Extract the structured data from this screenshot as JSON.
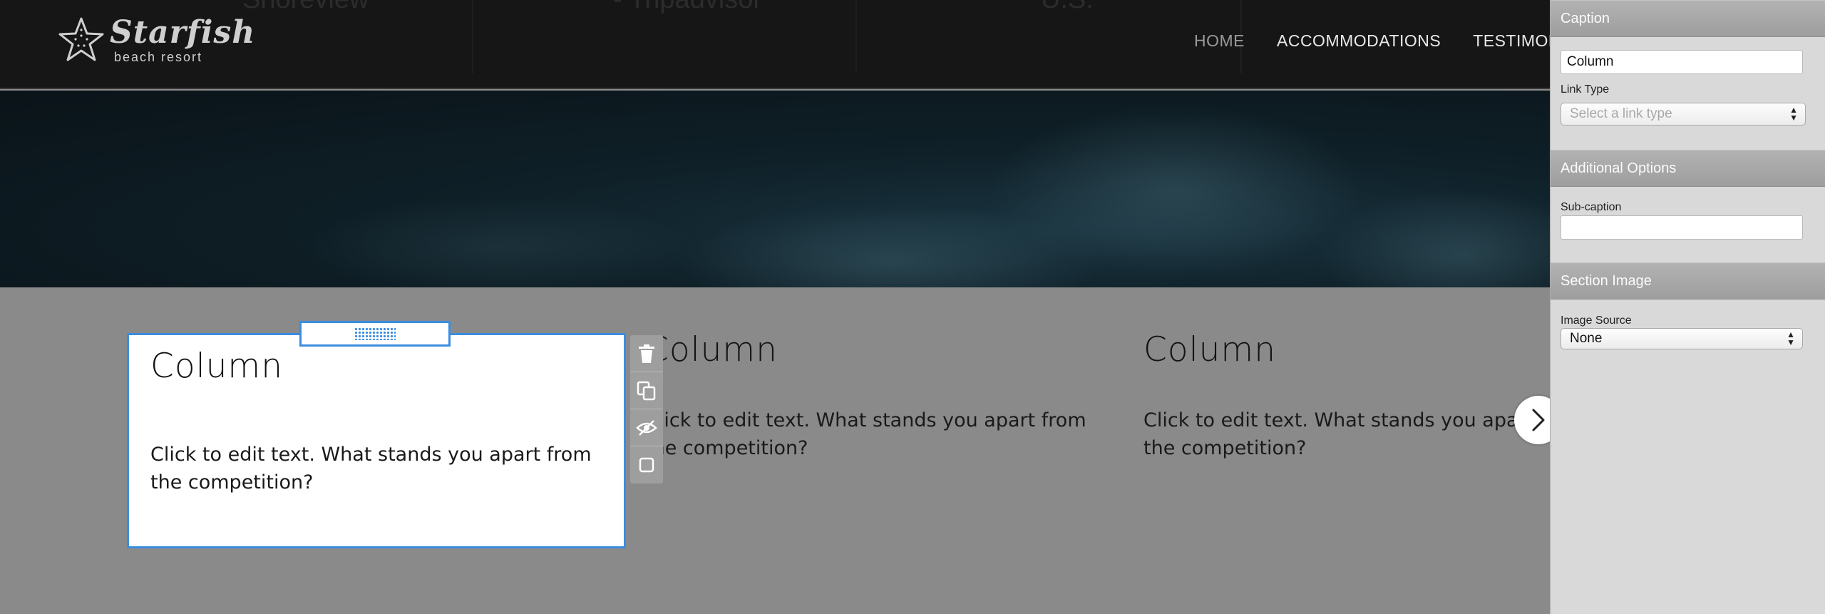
{
  "header": {
    "ghost_testimonials": [
      "Shoreview",
      "- Tripadvisor",
      "U.S."
    ],
    "logo": {
      "name": "Starfish",
      "tagline": "beach resort"
    },
    "nav": [
      {
        "label": "HOME",
        "active": true
      },
      {
        "label": "ACCOMMODATIONS",
        "active": false
      },
      {
        "label": "TESTIMONIA",
        "active": false
      }
    ]
  },
  "columns": [
    {
      "title": "Column",
      "text": "Click to edit text. What stands you apart from the competition?"
    },
    {
      "title": "Column",
      "text": "Click to edit text. What stands you apart from the competition?"
    },
    {
      "title": "Column",
      "text": "Click to edit text. What stands you apart from the competition?"
    }
  ],
  "editor_tools": [
    {
      "name": "delete",
      "icon": "trash-icon"
    },
    {
      "name": "duplicate",
      "icon": "copy-icon"
    },
    {
      "name": "toggle-visibility",
      "icon": "eye-slash-icon"
    },
    {
      "name": "select",
      "icon": "square-icon"
    }
  ],
  "panel": {
    "caption_section": "Caption",
    "caption_value": "Column",
    "link_type_label": "Link Type",
    "link_type_placeholder": "Select a link type",
    "additional_section": "Additional Options",
    "subcaption_label": "Sub-caption",
    "subcaption_value": "",
    "image_section": "Section Image",
    "image_source_label": "Image Source",
    "image_source_value": "None"
  },
  "colors": {
    "selection": "#3b8de0",
    "header_bg": "#161616",
    "content_bg": "#8a8a8a",
    "panel_bg": "#d9d9d9"
  }
}
